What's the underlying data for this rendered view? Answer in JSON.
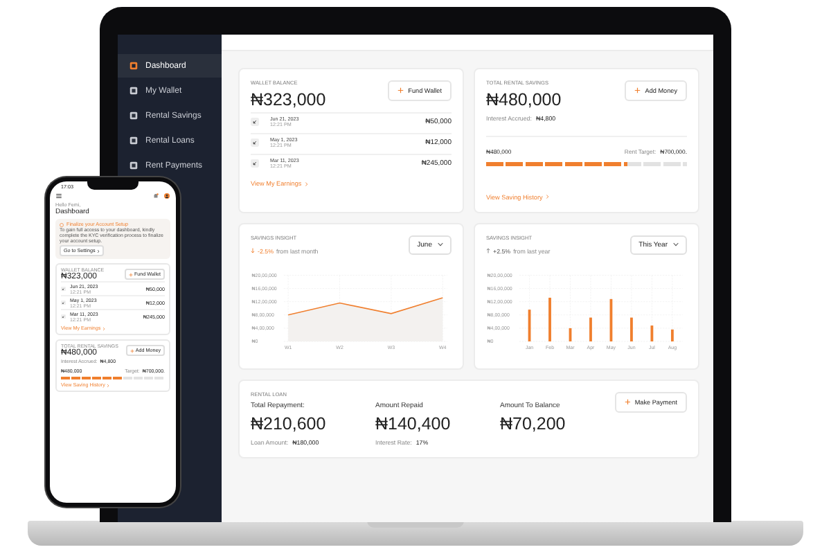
{
  "laptop": {
    "sidebar": {
      "items": [
        {
          "label": "Dashboard",
          "selected": true
        },
        {
          "label": "My Wallet",
          "selected": false
        },
        {
          "label": "Rental Savings",
          "selected": false
        },
        {
          "label": "Rental Loans",
          "selected": false
        },
        {
          "label": "Rent Payments",
          "selected": false
        }
      ]
    },
    "wallet": {
      "title": "WALLET BALANCE",
      "amount": "₦323,000",
      "button": "Fund Wallet",
      "transactions": [
        {
          "date": "Jun 21, 2023",
          "time": "12:21 PM",
          "amount": "₦50,000"
        },
        {
          "date": "May 1, 2023",
          "time": "12:21 PM",
          "amount": "₦12,000"
        },
        {
          "date": "Mar 11, 2023",
          "time": "12:21 PM",
          "amount": "₦245,000"
        }
      ],
      "link": "View My Earnings"
    },
    "savings": {
      "title": "TOTAL RENTAL SAVINGS",
      "amount": "₦480,000",
      "button": "Add Money",
      "interest_label": "Interest Accrued:",
      "interest": "₦4,800",
      "saved": "₦480,000",
      "target_label": "Rent Target:",
      "target": "₦700,000.",
      "level": 0.7,
      "link": "View Saving History"
    },
    "insights": [
      {
        "title": "SAVINGS INSIGHT",
        "decline": true,
        "change": "-2.5%",
        "period": "from last month",
        "dropdown": "June",
        "chart_data": {
          "type": "area",
          "grid": true,
          "categories": [
            "W1",
            "W2",
            "W3",
            "W4"
          ],
          "yticks": [
            {
              "value": 0,
              "label": "₦0"
            },
            {
              "value": 400000,
              "label": "₦4,00,000"
            },
            {
              "value": 800000,
              "label": "₦8,00,000"
            },
            {
              "value": 1200000,
              "label": "₦12,00,000"
            },
            {
              "value": 1600000,
              "label": "₦16,00,000"
            },
            {
              "value": 2000000,
              "label": "₦20,00,000"
            }
          ],
          "ylim": [
            0,
            2000000
          ],
          "series": [
            {
              "color": "#f07f2e",
              "values": [
                800000,
                1160000,
                840000,
                1320000
              ]
            }
          ]
        }
      },
      {
        "title": "SAVINGS INSIGHT",
        "decline": false,
        "change": "+2.5%",
        "period": "from last year",
        "dropdown": "This Year",
        "chart_data": {
          "type": "bar",
          "grid": true,
          "categories": [
            "Jan",
            "Feb",
            "Mar",
            "Apr",
            "May",
            "Jun",
            "Jul",
            "Aug"
          ],
          "yticks": [
            {
              "value": 0,
              "label": "₦0"
            },
            {
              "value": 400000,
              "label": "₦4,00,000"
            },
            {
              "value": 800000,
              "label": "₦8,00,000"
            },
            {
              "value": 1200000,
              "label": "₦12,00,000"
            },
            {
              "value": 1600000,
              "label": "₦16,00,000"
            },
            {
              "value": 2000000,
              "label": "₦20,00,000"
            }
          ],
          "ylim": [
            0,
            2000000
          ],
          "series": [
            {
              "color": "#f07f2e",
              "values": [
                960000,
                1320000,
                400000,
                720000,
                1280000,
                720000,
                480000,
                360000
              ]
            }
          ]
        }
      }
    ],
    "loan": {
      "title": "RENTAL LOAN",
      "button": "Make Payment",
      "stats": [
        {
          "label": "Total Repayment:",
          "value": "₦210,600",
          "sub_label": "Loan Amount:",
          "sub_value": "₦180,000"
        },
        {
          "label": "Amount Repaid",
          "value": "₦140,400",
          "sub_label": "Interest Rate:",
          "sub_value": "17%"
        },
        {
          "label": "Amount To Balance",
          "value": "₦70,200"
        }
      ]
    }
  },
  "phone": {
    "time": "17:03",
    "greeting": "Hello Femi,",
    "heading": "Dashboard",
    "alert": {
      "title": "Finalize your Account Setup",
      "text": "To gain full access to your dashboard, kindly complete the KYC verification process to finalize your account setup.",
      "button": "Go to Settings"
    },
    "wallet": {
      "title": "WALLET BALANCE",
      "amount": "₦323,000",
      "button": "Fund Wallet",
      "transactions": [
        {
          "date": "Jun 21, 2023",
          "time": "12:21 PM",
          "amount": "₦50,000"
        },
        {
          "date": "May 1, 2023",
          "time": "12:21 PM",
          "amount": "₦12,000"
        },
        {
          "date": "Mar 11, 2023",
          "time": "12:21 PM",
          "amount": "₦245,000"
        }
      ],
      "link": "View My Earnings"
    },
    "savings": {
      "title": "TOTAL RENTAL SAVINGS",
      "amount": "₦480,000",
      "button": "Add Money",
      "interest_label": "Interest Accrued:",
      "interest": "₦4,800",
      "saved": "₦480,000",
      "target_label": "Target:",
      "target": "₦700,000.",
      "level": 0.6,
      "link": "View Saving History"
    }
  }
}
